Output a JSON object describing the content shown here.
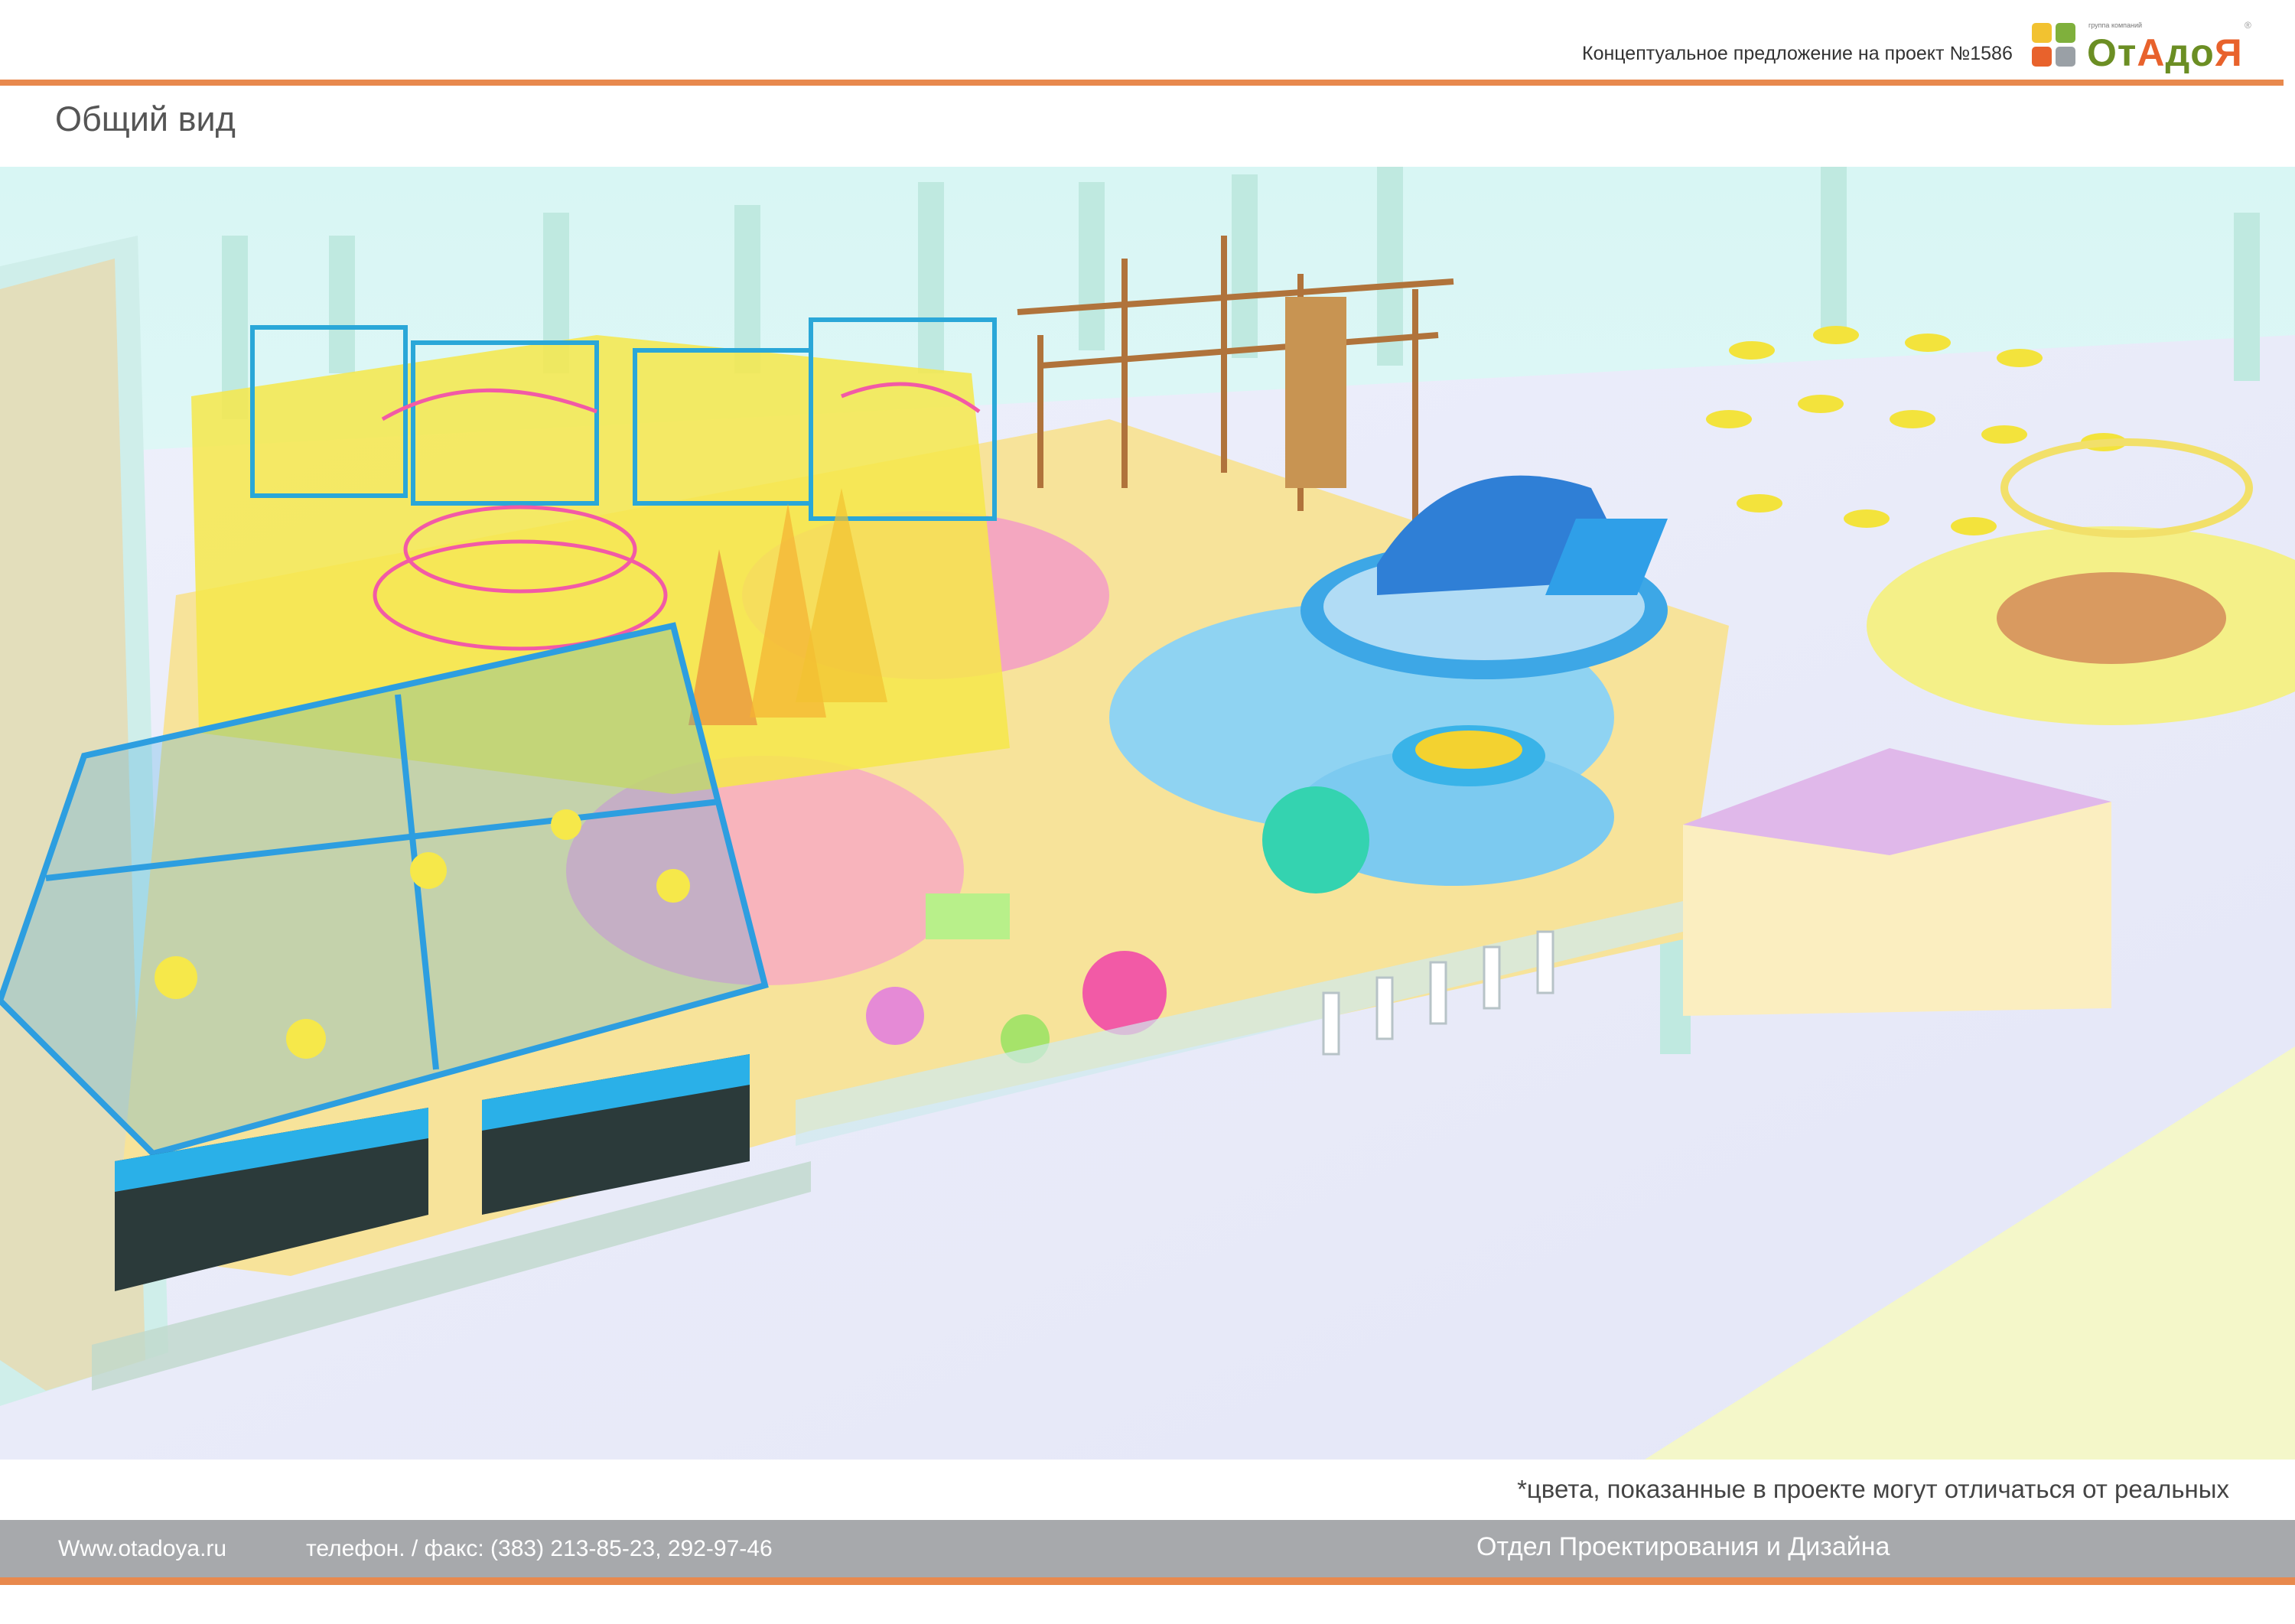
{
  "header": {
    "project_title": "Концептуальное предложение на проект  №1586",
    "logo": {
      "small_caption": "группа компаний",
      "name_part1": "От",
      "name_part2": "А",
      "name_part3": "до",
      "name_part4": "Я",
      "tile_colors": [
        "#f2c230",
        "#7fb03c",
        "#e8622c",
        "#9aa0a6"
      ]
    }
  },
  "page_title": "Общий вид",
  "render": {
    "icon": "playground-3d-render"
  },
  "disclaimer": "*цвета, показанные в проекте могут отличаться от реальных",
  "footer": {
    "website": "Www.otadoya.ru",
    "phone": "телефон. / факс:  (383) 213-85-23,  292-97-46",
    "department": "Отдел Проектирования и Дизайна"
  },
  "colors": {
    "accent": "#e8894d",
    "footer_band": "#a7a9ac",
    "logo_green": "#6b8e23",
    "logo_orange": "#e8622c"
  }
}
